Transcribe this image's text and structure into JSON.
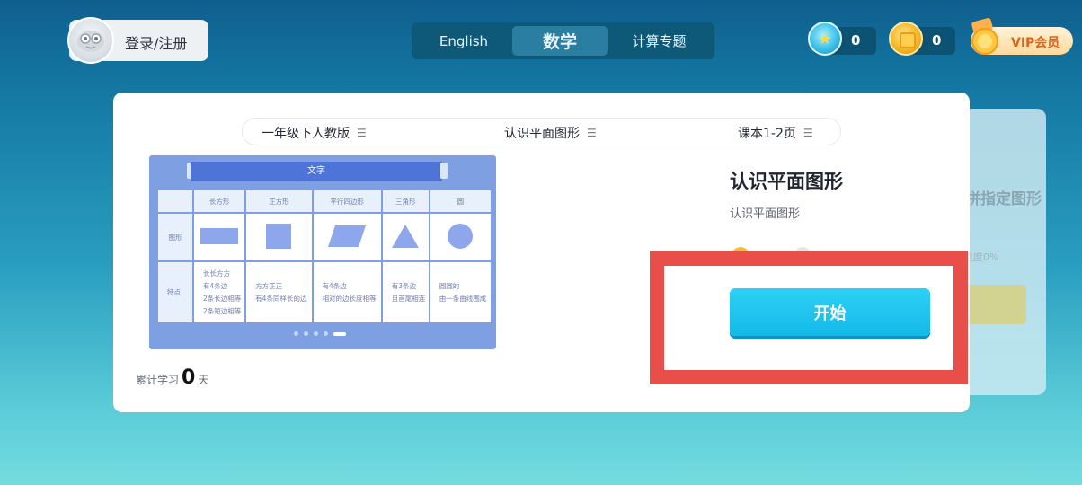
{
  "header": {
    "login_label": "登录/注册",
    "subject_tabs": [
      {
        "label": "English"
      },
      {
        "label": "数学"
      },
      {
        "label": "计算专题"
      }
    ],
    "diamonds": "0",
    "coins": "0",
    "vip_label": "VIP会员"
  },
  "filters": {
    "grade": "一年级下人教版",
    "unit": "认识平面图形",
    "pages": "课本1-2页"
  },
  "preview": {
    "banner": "文字",
    "columns": [
      "长方形",
      "正方形",
      "平行四边形",
      "三角形",
      "圆"
    ],
    "row_labels": [
      "图形",
      "特点"
    ],
    "features": [
      [
        "长长方方",
        "有4条边",
        "2条长边相等",
        "2条短边相等"
      ],
      [
        "方方正正",
        "有4条同样长的边"
      ],
      [
        "有4条边",
        "相对的边长度相等"
      ],
      [
        "有3条边",
        "且首尾相连"
      ],
      [
        "圆圆的",
        "由一条曲线围成"
      ]
    ]
  },
  "streak": {
    "prefix": "累计学习",
    "days": "0",
    "suffix": "天"
  },
  "lesson": {
    "title": "认识平面图形",
    "subtitle": "认识平面图形",
    "start_label": "开始"
  },
  "back_card": {
    "title": "拼指定图形",
    "progress": "进度0%"
  },
  "colors": {
    "accent": "#14b9e8",
    "highlight": "#e84e4a",
    "preview_bg": "#7e9fe2"
  }
}
